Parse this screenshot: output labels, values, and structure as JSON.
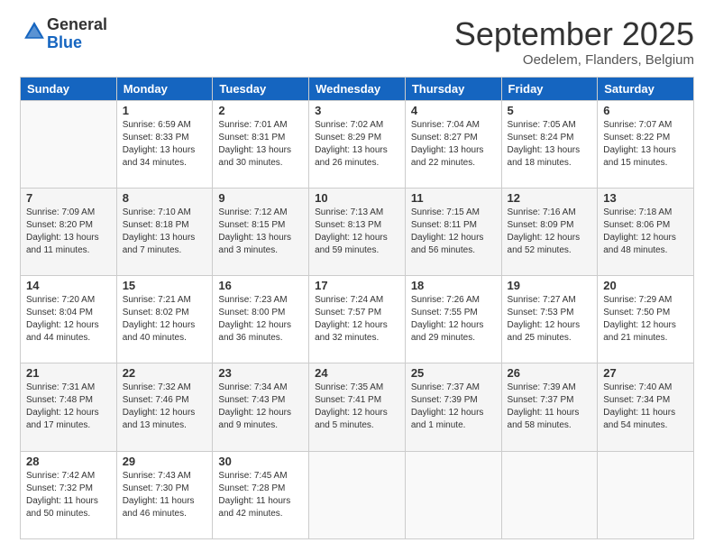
{
  "logo": {
    "general": "General",
    "blue": "Blue"
  },
  "header": {
    "month": "September 2025",
    "location": "Oedelem, Flanders, Belgium"
  },
  "weekdays": [
    "Sunday",
    "Monday",
    "Tuesday",
    "Wednesday",
    "Thursday",
    "Friday",
    "Saturday"
  ],
  "weeks": [
    [
      {
        "day": "",
        "sunrise": "",
        "sunset": "",
        "daylight": ""
      },
      {
        "day": "1",
        "sunrise": "Sunrise: 6:59 AM",
        "sunset": "Sunset: 8:33 PM",
        "daylight": "Daylight: 13 hours and 34 minutes."
      },
      {
        "day": "2",
        "sunrise": "Sunrise: 7:01 AM",
        "sunset": "Sunset: 8:31 PM",
        "daylight": "Daylight: 13 hours and 30 minutes."
      },
      {
        "day": "3",
        "sunrise": "Sunrise: 7:02 AM",
        "sunset": "Sunset: 8:29 PM",
        "daylight": "Daylight: 13 hours and 26 minutes."
      },
      {
        "day": "4",
        "sunrise": "Sunrise: 7:04 AM",
        "sunset": "Sunset: 8:27 PM",
        "daylight": "Daylight: 13 hours and 22 minutes."
      },
      {
        "day": "5",
        "sunrise": "Sunrise: 7:05 AM",
        "sunset": "Sunset: 8:24 PM",
        "daylight": "Daylight: 13 hours and 18 minutes."
      },
      {
        "day": "6",
        "sunrise": "Sunrise: 7:07 AM",
        "sunset": "Sunset: 8:22 PM",
        "daylight": "Daylight: 13 hours and 15 minutes."
      }
    ],
    [
      {
        "day": "7",
        "sunrise": "Sunrise: 7:09 AM",
        "sunset": "Sunset: 8:20 PM",
        "daylight": "Daylight: 13 hours and 11 minutes."
      },
      {
        "day": "8",
        "sunrise": "Sunrise: 7:10 AM",
        "sunset": "Sunset: 8:18 PM",
        "daylight": "Daylight: 13 hours and 7 minutes."
      },
      {
        "day": "9",
        "sunrise": "Sunrise: 7:12 AM",
        "sunset": "Sunset: 8:15 PM",
        "daylight": "Daylight: 13 hours and 3 minutes."
      },
      {
        "day": "10",
        "sunrise": "Sunrise: 7:13 AM",
        "sunset": "Sunset: 8:13 PM",
        "daylight": "Daylight: 12 hours and 59 minutes."
      },
      {
        "day": "11",
        "sunrise": "Sunrise: 7:15 AM",
        "sunset": "Sunset: 8:11 PM",
        "daylight": "Daylight: 12 hours and 56 minutes."
      },
      {
        "day": "12",
        "sunrise": "Sunrise: 7:16 AM",
        "sunset": "Sunset: 8:09 PM",
        "daylight": "Daylight: 12 hours and 52 minutes."
      },
      {
        "day": "13",
        "sunrise": "Sunrise: 7:18 AM",
        "sunset": "Sunset: 8:06 PM",
        "daylight": "Daylight: 12 hours and 48 minutes."
      }
    ],
    [
      {
        "day": "14",
        "sunrise": "Sunrise: 7:20 AM",
        "sunset": "Sunset: 8:04 PM",
        "daylight": "Daylight: 12 hours and 44 minutes."
      },
      {
        "day": "15",
        "sunrise": "Sunrise: 7:21 AM",
        "sunset": "Sunset: 8:02 PM",
        "daylight": "Daylight: 12 hours and 40 minutes."
      },
      {
        "day": "16",
        "sunrise": "Sunrise: 7:23 AM",
        "sunset": "Sunset: 8:00 PM",
        "daylight": "Daylight: 12 hours and 36 minutes."
      },
      {
        "day": "17",
        "sunrise": "Sunrise: 7:24 AM",
        "sunset": "Sunset: 7:57 PM",
        "daylight": "Daylight: 12 hours and 32 minutes."
      },
      {
        "day": "18",
        "sunrise": "Sunrise: 7:26 AM",
        "sunset": "Sunset: 7:55 PM",
        "daylight": "Daylight: 12 hours and 29 minutes."
      },
      {
        "day": "19",
        "sunrise": "Sunrise: 7:27 AM",
        "sunset": "Sunset: 7:53 PM",
        "daylight": "Daylight: 12 hours and 25 minutes."
      },
      {
        "day": "20",
        "sunrise": "Sunrise: 7:29 AM",
        "sunset": "Sunset: 7:50 PM",
        "daylight": "Daylight: 12 hours and 21 minutes."
      }
    ],
    [
      {
        "day": "21",
        "sunrise": "Sunrise: 7:31 AM",
        "sunset": "Sunset: 7:48 PM",
        "daylight": "Daylight: 12 hours and 17 minutes."
      },
      {
        "day": "22",
        "sunrise": "Sunrise: 7:32 AM",
        "sunset": "Sunset: 7:46 PM",
        "daylight": "Daylight: 12 hours and 13 minutes."
      },
      {
        "day": "23",
        "sunrise": "Sunrise: 7:34 AM",
        "sunset": "Sunset: 7:43 PM",
        "daylight": "Daylight: 12 hours and 9 minutes."
      },
      {
        "day": "24",
        "sunrise": "Sunrise: 7:35 AM",
        "sunset": "Sunset: 7:41 PM",
        "daylight": "Daylight: 12 hours and 5 minutes."
      },
      {
        "day": "25",
        "sunrise": "Sunrise: 7:37 AM",
        "sunset": "Sunset: 7:39 PM",
        "daylight": "Daylight: 12 hours and 1 minute."
      },
      {
        "day": "26",
        "sunrise": "Sunrise: 7:39 AM",
        "sunset": "Sunset: 7:37 PM",
        "daylight": "Daylight: 11 hours and 58 minutes."
      },
      {
        "day": "27",
        "sunrise": "Sunrise: 7:40 AM",
        "sunset": "Sunset: 7:34 PM",
        "daylight": "Daylight: 11 hours and 54 minutes."
      }
    ],
    [
      {
        "day": "28",
        "sunrise": "Sunrise: 7:42 AM",
        "sunset": "Sunset: 7:32 PM",
        "daylight": "Daylight: 11 hours and 50 minutes."
      },
      {
        "day": "29",
        "sunrise": "Sunrise: 7:43 AM",
        "sunset": "Sunset: 7:30 PM",
        "daylight": "Daylight: 11 hours and 46 minutes."
      },
      {
        "day": "30",
        "sunrise": "Sunrise: 7:45 AM",
        "sunset": "Sunset: 7:28 PM",
        "daylight": "Daylight: 11 hours and 42 minutes."
      },
      {
        "day": "",
        "sunrise": "",
        "sunset": "",
        "daylight": ""
      },
      {
        "day": "",
        "sunrise": "",
        "sunset": "",
        "daylight": ""
      },
      {
        "day": "",
        "sunrise": "",
        "sunset": "",
        "daylight": ""
      },
      {
        "day": "",
        "sunrise": "",
        "sunset": "",
        "daylight": ""
      }
    ]
  ]
}
